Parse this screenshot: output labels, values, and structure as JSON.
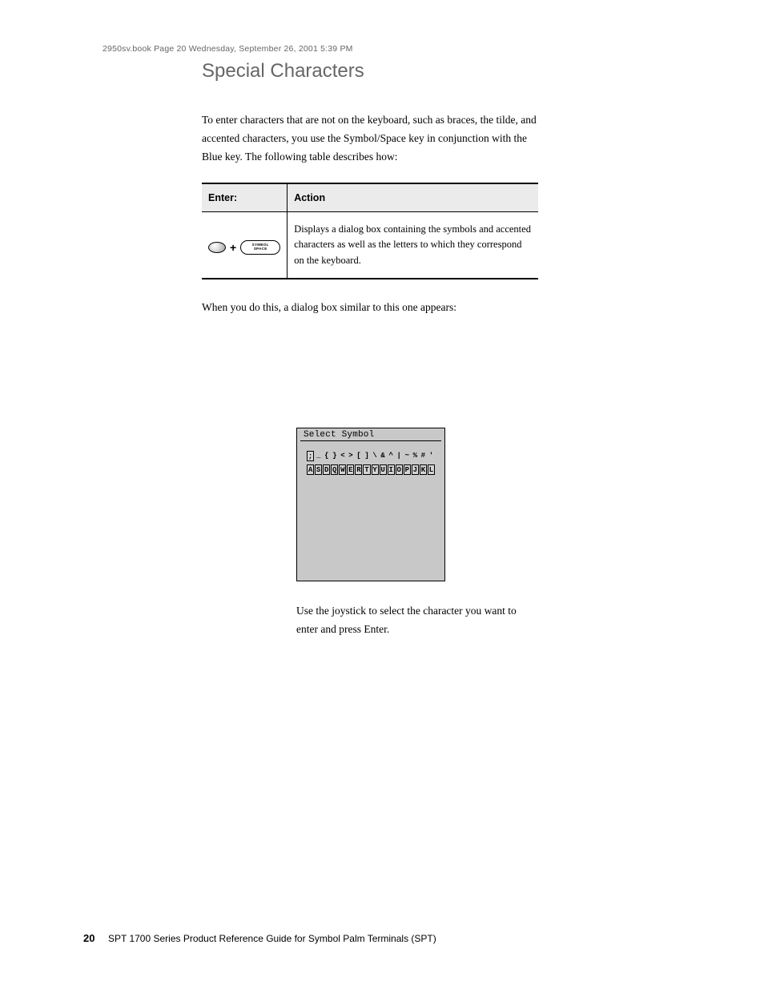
{
  "runhead": {
    "line1": "2950sv.book  Page 20  Wednesday, September 26, 2001  5:39 PM",
    "line2": ""
  },
  "page": {
    "title": "Special Characters",
    "intro": "To enter characters that are not on the keyboard, such as braces, the tilde, and accented characters, you use the Symbol/Space key in conjunction with the Blue key. The following table describes how:",
    "after_table": "When you do this, a dialog box similar to this one appears:",
    "note": "Use the joystick to select the character you want to enter and press Enter.",
    "footer_page": "20",
    "footer_title": "SPT 1700 Series Product Reference Guide for Symbol Palm Terminals (SPT)"
  },
  "table": {
    "headers": {
      "left": "Enter:",
      "right": "Action"
    },
    "row": {
      "left_key_top": "SYMBOL",
      "left_key_bottom": "SPACE",
      "right": "Displays a dialog box containing the symbols and accented characters as well as the letters to which they correspond on the keyboard."
    }
  },
  "symbol_panel": {
    "title": "Select Symbol",
    "row1": [
      ";",
      "_",
      "{",
      "}",
      "<",
      ">",
      "[",
      "]",
      "\\",
      "&",
      "^",
      "|",
      "~",
      "%",
      "#",
      "'"
    ],
    "row1_boxed": [
      true,
      false,
      false,
      false,
      false,
      false,
      false,
      false,
      false,
      false,
      false,
      false,
      false,
      false,
      false,
      false
    ],
    "row2": [
      "A",
      "S",
      "D",
      "Q",
      "W",
      "E",
      "R",
      "T",
      "Y",
      "U",
      "I",
      "O",
      "P",
      "J",
      "K",
      "L"
    ],
    "row2_boxed": [
      true,
      true,
      true,
      true,
      true,
      true,
      true,
      true,
      true,
      true,
      true,
      true,
      true,
      true,
      true,
      true
    ]
  }
}
